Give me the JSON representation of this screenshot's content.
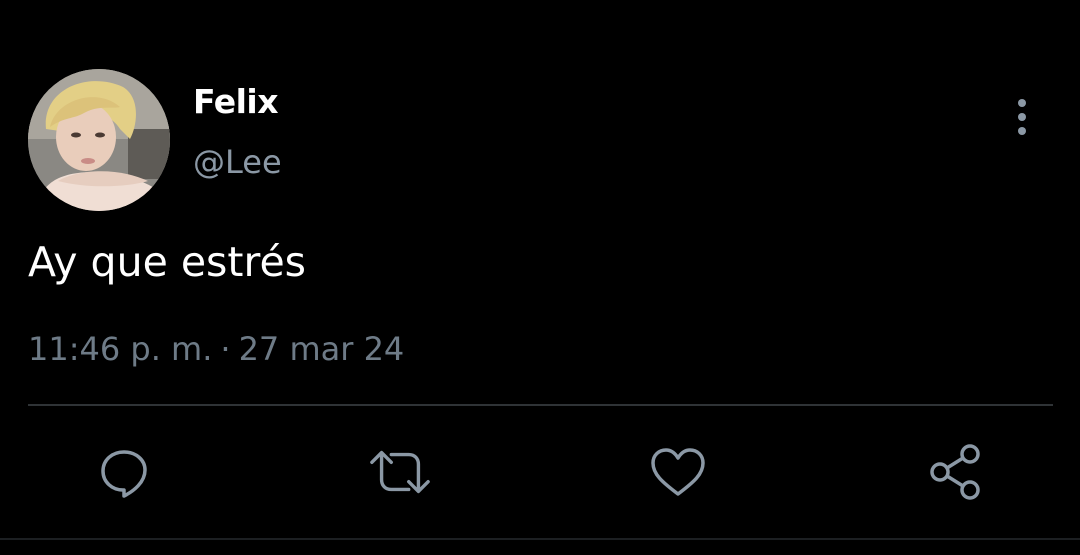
{
  "tweet": {
    "display_name": "Felix",
    "handle": "@Lee",
    "text": "Ay que estrés",
    "time": "11:46 p. m.",
    "separator": "·",
    "date": "27 mar 24",
    "avatar_icon": "profile-photo"
  },
  "actions": [
    {
      "icon": "reply-icon"
    },
    {
      "icon": "retweet-icon"
    },
    {
      "icon": "like-icon"
    },
    {
      "icon": "share-icon"
    }
  ],
  "colors": {
    "background": "#000000",
    "primary_text": "#ffffff",
    "secondary_text": "#8b98a5",
    "divider": "#2f3336"
  }
}
